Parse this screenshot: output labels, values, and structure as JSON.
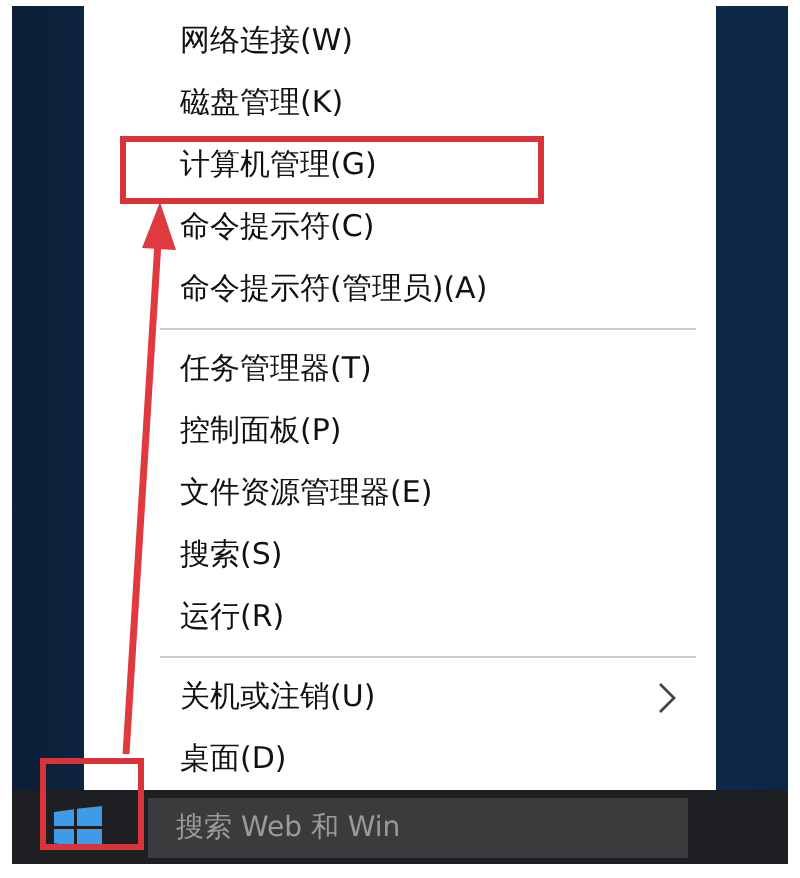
{
  "menu": {
    "items": [
      {
        "kind": "item",
        "label": "网络连接(W)",
        "annotated": false,
        "submenu": false
      },
      {
        "kind": "item",
        "label": "磁盘管理(K)",
        "annotated": false,
        "submenu": false
      },
      {
        "kind": "item",
        "label": "计算机管理(G)",
        "annotated": true,
        "submenu": false
      },
      {
        "kind": "item",
        "label": "命令提示符(C)",
        "annotated": false,
        "submenu": false
      },
      {
        "kind": "item",
        "label": "命令提示符(管理员)(A)",
        "annotated": false,
        "submenu": false
      },
      {
        "kind": "separator"
      },
      {
        "kind": "item",
        "label": "任务管理器(T)",
        "annotated": false,
        "submenu": false
      },
      {
        "kind": "item",
        "label": "控制面板(P)",
        "annotated": false,
        "submenu": false
      },
      {
        "kind": "item",
        "label": "文件资源管理器(E)",
        "annotated": false,
        "submenu": false
      },
      {
        "kind": "item",
        "label": "搜索(S)",
        "annotated": false,
        "submenu": false
      },
      {
        "kind": "item",
        "label": "运行(R)",
        "annotated": false,
        "submenu": false
      },
      {
        "kind": "separator"
      },
      {
        "kind": "item",
        "label": "关机或注销(U)",
        "annotated": false,
        "submenu": true
      },
      {
        "kind": "item",
        "label": "桌面(D)",
        "annotated": false,
        "submenu": false
      }
    ]
  },
  "taskbar": {
    "start_annotated": true,
    "search_placeholder": "搜索 Web 和 Win"
  }
}
